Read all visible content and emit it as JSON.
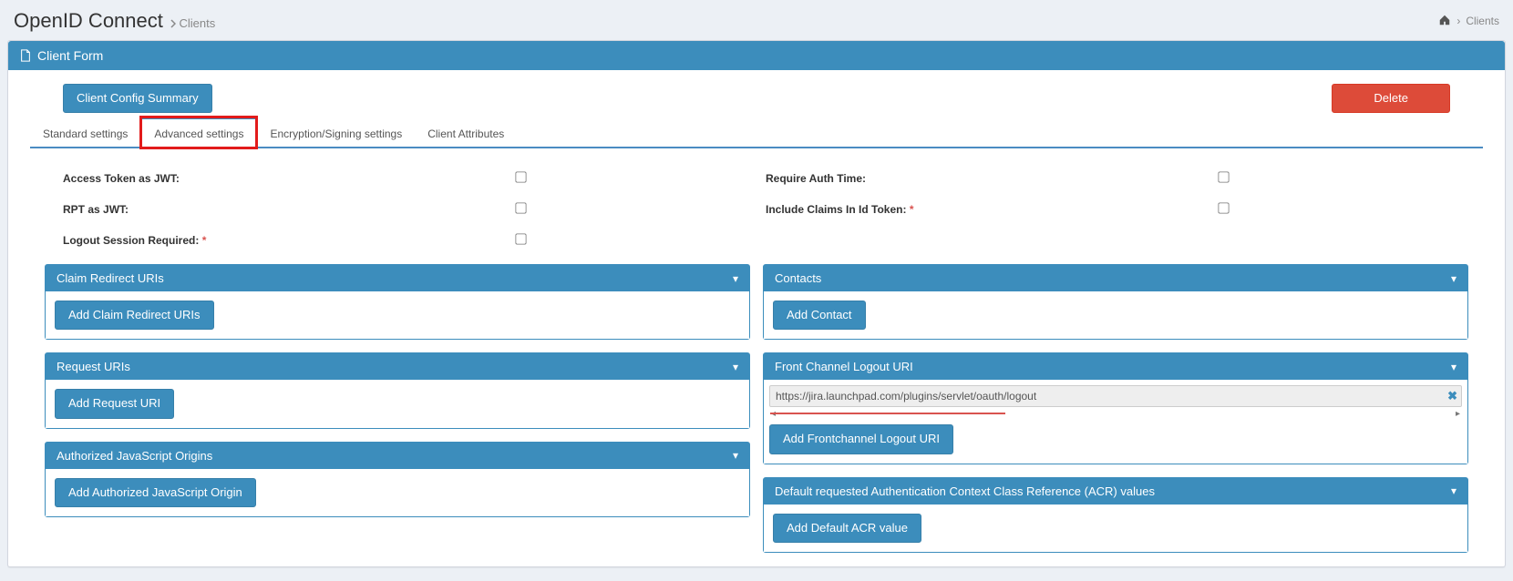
{
  "header": {
    "title": "OpenID Connect",
    "subnav": "Clients",
    "breadcrumb_active": "Clients"
  },
  "box": {
    "card_title": "Client Form",
    "summary_btn": "Client Config Summary",
    "delete_btn": "Delete"
  },
  "tabs": {
    "standard": "Standard settings",
    "advanced": "Advanced settings",
    "encryption": "Encryption/Signing settings",
    "attributes": "Client Attributes"
  },
  "labels": {
    "access_token_jwt": "Access Token as JWT:",
    "rpt_jwt": "RPT as JWT:",
    "logout_session_required": "Logout Session Required:",
    "require_auth_time": "Require Auth Time:",
    "include_claims": "Include Claims In Id Token:"
  },
  "panels": {
    "claim_redirect": {
      "title": "Claim Redirect URIs",
      "btn": "Add Claim Redirect URIs"
    },
    "request_uris": {
      "title": "Request URIs",
      "btn": "Add Request URI"
    },
    "authorized_js": {
      "title": "Authorized JavaScript Origins",
      "btn": "Add Authorized JavaScript Origin"
    },
    "contacts": {
      "title": "Contacts",
      "btn": "Add Contact"
    },
    "front_channel": {
      "title": "Front Channel Logout URI",
      "value": "https://jira.launchpad.com/plugins/servlet/oauth/logout",
      "btn": "Add Frontchannel Logout URI"
    },
    "acr": {
      "title": "Default requested Authentication Context Class Reference (ACR) values",
      "btn": "Add Default ACR value"
    }
  }
}
